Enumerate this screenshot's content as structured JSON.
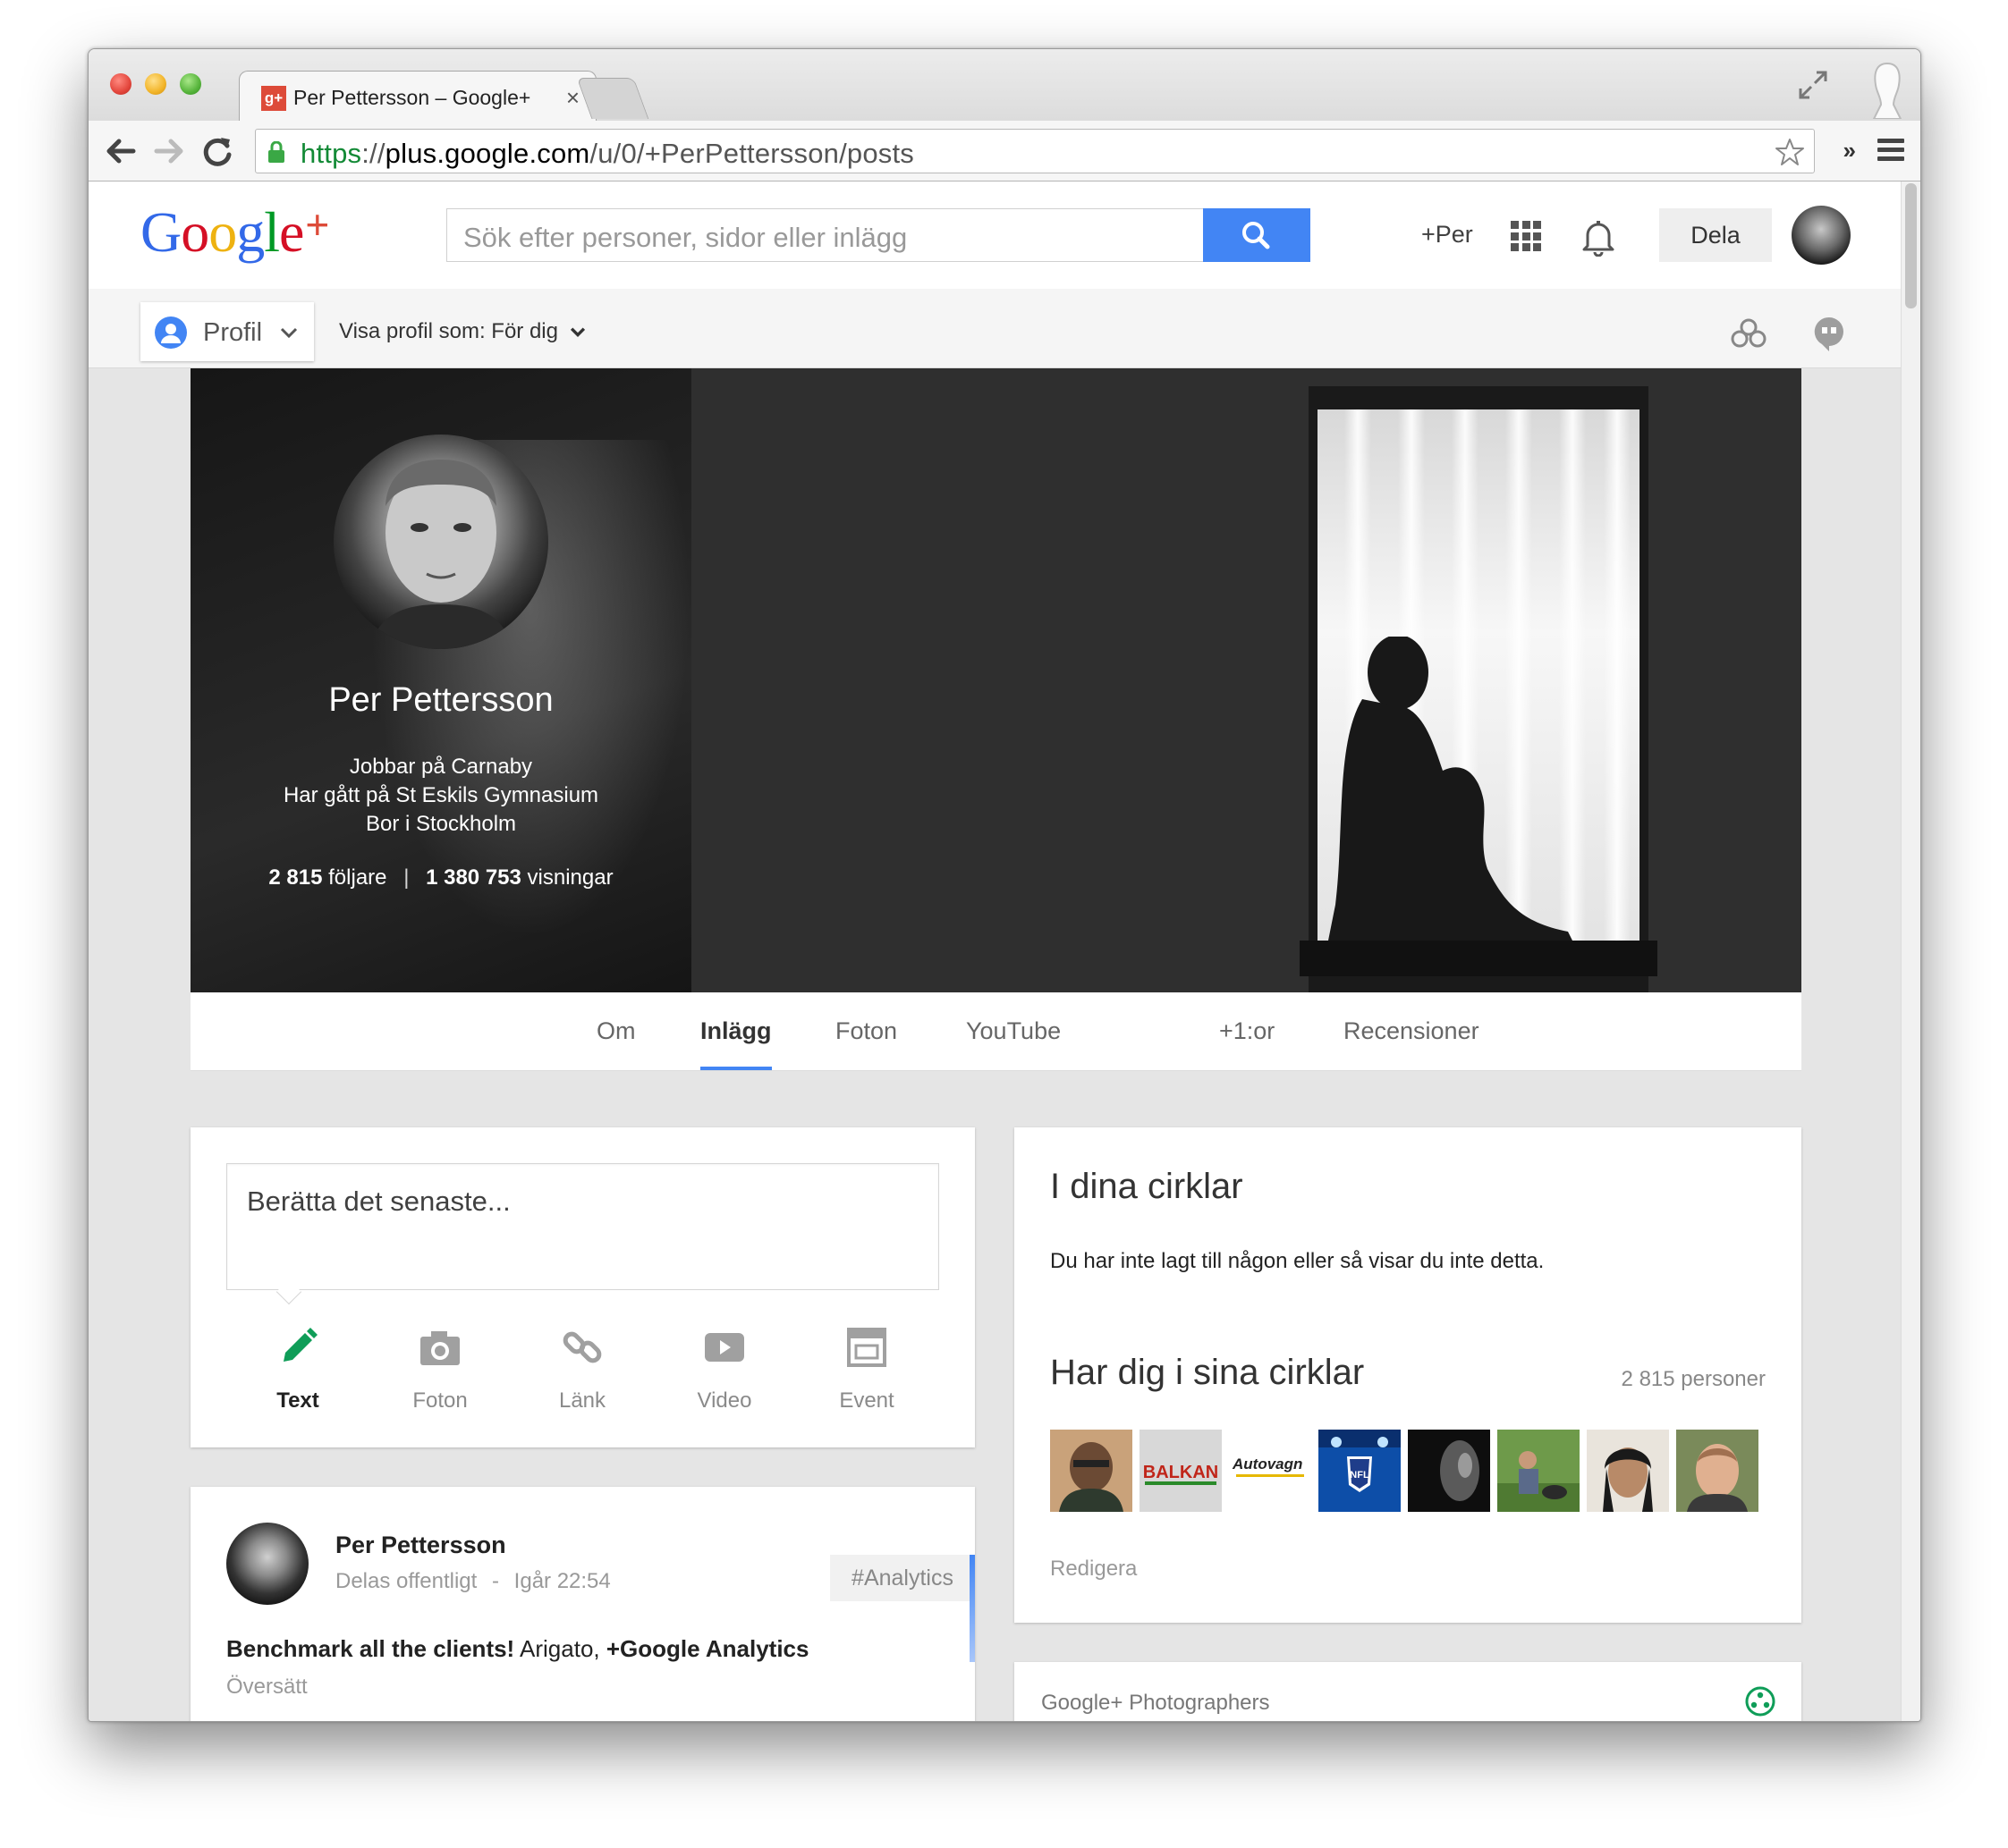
{
  "browser": {
    "tab_title": "Per Pettersson – Google+",
    "tab_favicon": "g+",
    "tab_close": "×",
    "url_scheme": "https",
    "url_sep": "://",
    "url_host": "plus.google.com",
    "url_path": "/u/0/+PerPettersson/posts",
    "extensions_chevron": "»"
  },
  "header": {
    "logo_letters": [
      "G",
      "o",
      "o",
      "g",
      "l",
      "e"
    ],
    "logo_plus": "+",
    "search_placeholder": "Sök efter personer, sidor eller inlägg",
    "plus_user": "+Per",
    "share_button": "Dela"
  },
  "subheader": {
    "profile_button": "Profil",
    "view_as_label": "Visa profil som: För dig"
  },
  "profile": {
    "name": "Per Pettersson",
    "works_at": "Jobbar på Carnaby",
    "studied_at": "Har gått på St Eskils Gymnasium",
    "lives_in": "Bor i Stockholm",
    "followers_count": "2 815",
    "followers_label": "följare",
    "views_count": "1 380 753",
    "views_label": "visningar",
    "stats_separator": "|"
  },
  "tabs": [
    {
      "label": "Om"
    },
    {
      "label": "Inlägg",
      "active": true
    },
    {
      "label": "Foton"
    },
    {
      "label": "YouTube"
    },
    {
      "label": "+1:or"
    },
    {
      "label": "Recensioner"
    }
  ],
  "composer": {
    "placeholder": "Berätta det senaste...",
    "actions": [
      {
        "label": "Text",
        "icon": "pencil-icon",
        "active": true
      },
      {
        "label": "Foton",
        "icon": "camera-icon"
      },
      {
        "label": "Länk",
        "icon": "link-icon"
      },
      {
        "label": "Video",
        "icon": "video-icon"
      },
      {
        "label": "Event",
        "icon": "event-icon"
      }
    ]
  },
  "post": {
    "author": "Per Pettersson",
    "visibility": "Delas offentligt",
    "meta_separator": "-",
    "time": "Igår 22:54",
    "hashtag": "#Analytics",
    "body_bold": "Benchmark all the clients!",
    "body_text": "Arigato,",
    "body_mention": "+Google Analytics",
    "translate": "Översätt"
  },
  "circles": {
    "in_your_circles_title": "I dina cirklar",
    "in_your_circles_text": "Du har inte lagt till någon eller så visar du inte detta.",
    "has_you_title": "Har dig i sina cirklar",
    "has_you_count": "2 815 personer",
    "thumbs": [
      {
        "kind": "person"
      },
      {
        "kind": "logo",
        "text": "BALKAN"
      },
      {
        "kind": "logo",
        "text": "Autovagn"
      },
      {
        "kind": "logo",
        "text": "NFL"
      },
      {
        "kind": "person"
      },
      {
        "kind": "person"
      },
      {
        "kind": "person"
      },
      {
        "kind": "person"
      }
    ],
    "edit_link": "Redigera"
  },
  "community": {
    "title": "Google+ Photographers"
  },
  "colors": {
    "accent_blue": "#4285f4",
    "gplus_red": "#dd4b39",
    "pencil_green": "#0f9d58"
  }
}
